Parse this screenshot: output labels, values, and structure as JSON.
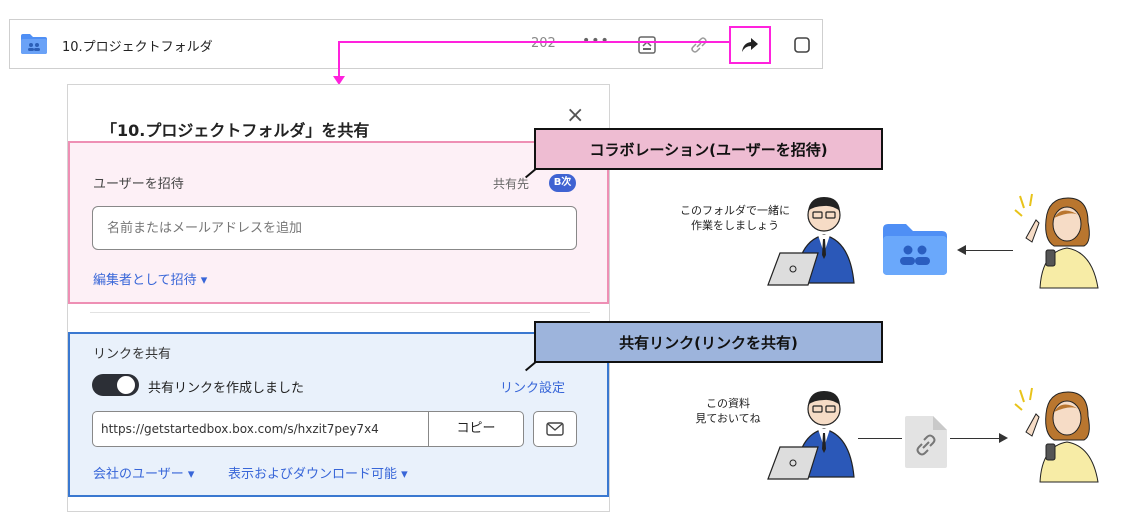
{
  "file_row": {
    "folder_name": "10.プロジェクトフォルダ",
    "date": "202",
    "more": "•••",
    "icons": [
      "upload-icon",
      "link-icon",
      "share-icon",
      "checkbox-icon"
    ]
  },
  "dialog": {
    "title": "「10.プロジェクトフォルダ」を共有",
    "close": "×",
    "collaboration": {
      "label": "ユーザーを招待",
      "share_dest_label": "共有先",
      "badge": "B次",
      "input_placeholder": "名前またはメールアドレスを追加",
      "role_dropdown": "編集者として招待 ▾"
    },
    "link": {
      "label": "リンクを共有",
      "toggle_text": "共有リンクを作成しました",
      "toggle_on": true,
      "settings": "リンク設定",
      "url": "https://getstartedbox.box.com/s/hxzit7pey7x4",
      "copy_button": "コピー",
      "scope_dropdown": "会社のユーザー ▾",
      "permission_dropdown": "表示およびダウンロード可能 ▾"
    }
  },
  "callouts": {
    "collaboration": "コラボレーション(ユーザーを招待)",
    "link": "共有リンク(リンクを共有)"
  },
  "illustrations": {
    "speech_1_line1": "このフォルダで一緒に",
    "speech_1_line2": "作業をしましょう",
    "speech_2_line1": "この資料",
    "speech_2_line2": "見ておいてね"
  },
  "colors": {
    "accent_blue": "#3866d8",
    "highlight_magenta": "#ff22dd",
    "collab_fill": "#fdf0f6",
    "link_fill": "#e9f1fb",
    "folder_blue": "#4f8ff5"
  }
}
